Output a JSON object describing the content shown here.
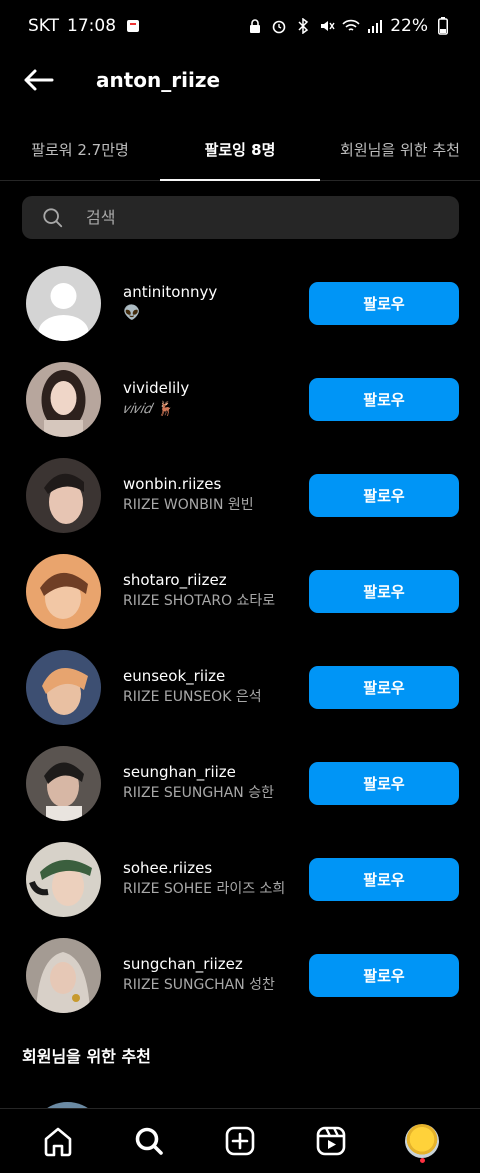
{
  "status_bar": {
    "carrier": "SKT",
    "time": "17:08",
    "battery": "22%"
  },
  "header": {
    "title": "anton_riize"
  },
  "tabs": [
    {
      "label": "팔로워 2.7만명"
    },
    {
      "label": "팔로잉 8명"
    },
    {
      "label": "회원님을 위한 추천"
    }
  ],
  "search": {
    "placeholder": "검색"
  },
  "following": [
    {
      "username": "antinitonnyy",
      "subtitle": "👽",
      "button": "팔로우",
      "avatar_colors": [
        "#c8c8c8",
        "#ffffff"
      ]
    },
    {
      "username": "vividelily",
      "subtitle": "𝑣𝑖𝑣𝑖𝑑 🦌",
      "button": "팔로우",
      "avatar_colors": [
        "#c2b1a8",
        "#2d211d"
      ]
    },
    {
      "username": "wonbin.riizes",
      "subtitle": "RIIZE WONBIN 원빈",
      "button": "팔로우",
      "avatar_colors": [
        "#3b3432",
        "#e7c5b3"
      ]
    },
    {
      "username": "shotaro_riizez",
      "subtitle": "RIIZE SHOTARO 쇼타로",
      "button": "팔로우",
      "avatar_colors": [
        "#e9a46d",
        "#6f3e25"
      ]
    },
    {
      "username": "eunseok_riize",
      "subtitle": "RIIZE EUNSEOK 은석",
      "button": "팔로우",
      "avatar_colors": [
        "#3d4f72",
        "#e7a46f"
      ]
    },
    {
      "username": "seunghan_riize",
      "subtitle": "RIIZE SEUNGHAN 승한",
      "button": "팔로우",
      "avatar_colors": [
        "#5a5450",
        "#d7b7a5"
      ]
    },
    {
      "username": "sohee.riizes",
      "subtitle": "RIIZE SOHEE 라이즈 소희",
      "button": "팔로우",
      "avatar_colors": [
        "#d7d2c9",
        "#3b5f3e"
      ]
    },
    {
      "username": "sungchan_riizez",
      "subtitle": "RIIZE SUNGCHAN 성찬",
      "button": "팔로우",
      "avatar_colors": [
        "#a49b93",
        "#d8d0c8"
      ]
    }
  ],
  "recommendations": {
    "title": "회원님을 위한 추천"
  },
  "bottom_nav": [
    {
      "icon": "home-icon"
    },
    {
      "icon": "search-icon"
    },
    {
      "icon": "create-icon"
    },
    {
      "icon": "reels-icon"
    },
    {
      "icon": "profile-avatar"
    }
  ],
  "colors": {
    "accent": "#0095f6",
    "background": "#000000",
    "search_bg": "#262626",
    "muted_text": "#a8a8a8"
  }
}
